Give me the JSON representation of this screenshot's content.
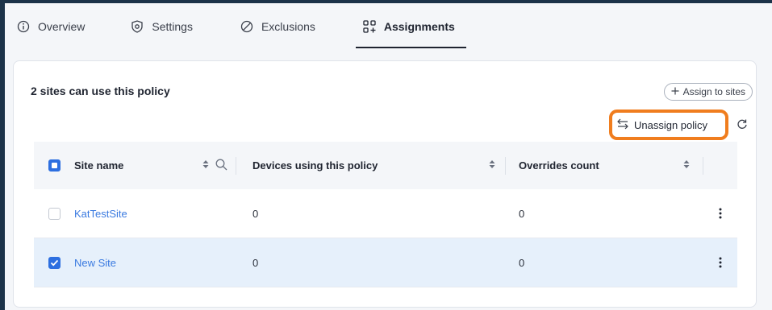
{
  "tabs": [
    {
      "label": "Overview",
      "icon": "info-icon",
      "active": false
    },
    {
      "label": "Settings",
      "icon": "settings-icon",
      "active": false
    },
    {
      "label": "Exclusions",
      "icon": "ban-icon",
      "active": false
    },
    {
      "label": "Assignments",
      "icon": "assignments-icon",
      "active": true
    }
  ],
  "card": {
    "title": "2 sites can use this policy",
    "assign_label": "Assign to sites",
    "unassign_label": "Unassign policy"
  },
  "table": {
    "columns": [
      "Site name",
      "Devices using this policy",
      "Overrides count"
    ],
    "rows": [
      {
        "site": "KatTestSite",
        "devices": "0",
        "overrides": "0",
        "selected": false
      },
      {
        "site": "New Site",
        "devices": "0",
        "overrides": "0",
        "selected": true
      }
    ]
  },
  "colors": {
    "accent": "#2d6fe0",
    "link": "#3a7ae0",
    "highlight": "#f07d1e",
    "background": "#1c3349",
    "selected_row": "#e6f0fb"
  }
}
